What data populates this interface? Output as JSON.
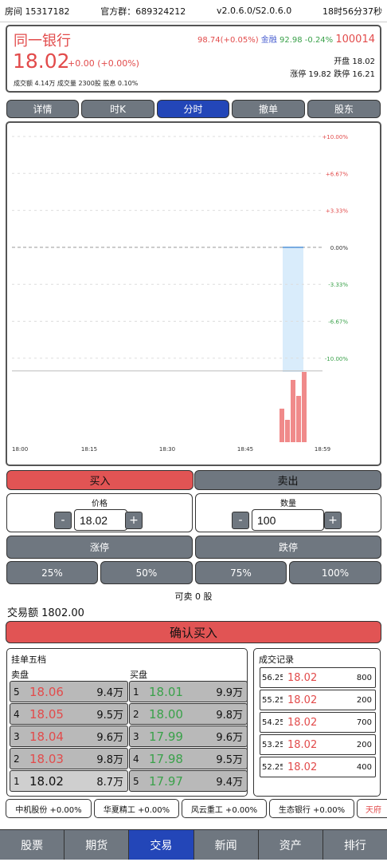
{
  "topbar": {
    "room": "房间 15317182",
    "group": "官方群：689324212",
    "version": "v2.0.6.0/S2.0.6.0",
    "time": "18时56分37秒"
  },
  "stock": {
    "name": "同一银行",
    "price": "18.02",
    "change": "+0.00 (+0.00%)",
    "stats": "成交额 4.14万  成交量 2300股  股息 0.10%",
    "index_value": "98.74(+0.05%)",
    "index_name": "金融",
    "index2_value": "92.98 -0.24%",
    "code": "100014",
    "open": "开盘 18.02",
    "limits": "涨停 19.82  跌停 16.21"
  },
  "tabs": [
    {
      "label": "详情"
    },
    {
      "label": "时K"
    },
    {
      "label": "分时"
    },
    {
      "label": "撤单"
    },
    {
      "label": "股东"
    }
  ],
  "chart_data": {
    "type": "bar",
    "y_ticks": [
      "+10.00%",
      "+6.67%",
      "+3.33%",
      "0.00%",
      "-3.33%",
      "-6.67%",
      "-10.00%"
    ],
    "x_ticks": [
      "18:00",
      "18:15",
      "18:30",
      "18:45",
      "18:59"
    ],
    "price_change_pct": 0.0,
    "volume_bars": [
      0.42,
      0.28,
      0.78,
      0.58,
      0.88
    ],
    "colors": {
      "up": "#e24b4b",
      "down": "#3aa14a",
      "volume": "#f08a8a",
      "price_band": "#d9ecfb"
    }
  },
  "trade": {
    "buy_label": "买入",
    "sell_label": "卖出",
    "price_label": "价格",
    "price_value": "18.02",
    "qty_label": "数量",
    "qty_value": "100",
    "minus": "-",
    "plus": "+",
    "limit_up": "涨停",
    "limit_down": "跌停",
    "pct_25": "25%",
    "pct_50": "50%",
    "pct_75": "75%",
    "pct_100": "100%",
    "sellable": "可卖 0 股",
    "amount": "交易额 1802.00",
    "confirm": "确认买入"
  },
  "order_book": {
    "title": "挂单五档",
    "sell_title": "卖盘",
    "buy_title": "买盘",
    "sell": [
      {
        "level": "5",
        "price": "18.06",
        "volume": "9.4万"
      },
      {
        "level": "4",
        "price": "18.05",
        "volume": "9.5万"
      },
      {
        "level": "3",
        "price": "18.04",
        "volume": "9.6万"
      },
      {
        "level": "2",
        "price": "18.03",
        "volume": "9.8万"
      },
      {
        "level": "1",
        "price": "18.02",
        "volume": "8.7万"
      }
    ],
    "buy": [
      {
        "level": "1",
        "price": "18.01",
        "volume": "9.9万"
      },
      {
        "level": "2",
        "price": "18.00",
        "volume": "9.8万"
      },
      {
        "level": "3",
        "price": "17.99",
        "volume": "9.6万"
      },
      {
        "level": "4",
        "price": "17.98",
        "volume": "9.5万"
      },
      {
        "level": "5",
        "price": "17.97",
        "volume": "9.4万"
      }
    ]
  },
  "records": {
    "title": "成交记录",
    "rows": [
      {
        "time": "56.25",
        "price": "18.02",
        "volume": "800"
      },
      {
        "time": "55.25",
        "price": "18.02",
        "volume": "200"
      },
      {
        "time": "54.25",
        "price": "18.02",
        "volume": "700"
      },
      {
        "time": "53.25",
        "price": "18.02",
        "volume": "200"
      },
      {
        "time": "52.25",
        "price": "18.02",
        "volume": "400"
      }
    ]
  },
  "ticker": [
    {
      "text": "中机股份 +0.00%"
    },
    {
      "text": "华夏精工 +0.00%"
    },
    {
      "text": "风云重工 +0.00%"
    },
    {
      "text": "生态银行 +0.00%"
    },
    {
      "text": "天府"
    }
  ],
  "nav": [
    {
      "label": "股票"
    },
    {
      "label": "期货"
    },
    {
      "label": "交易"
    },
    {
      "label": "新闻"
    },
    {
      "label": "资产"
    },
    {
      "label": "排行"
    }
  ]
}
